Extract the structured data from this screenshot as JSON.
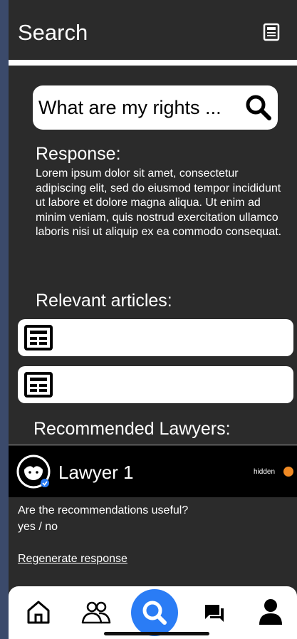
{
  "header": {
    "title": "Search"
  },
  "search": {
    "query": "What are my rights ..."
  },
  "response": {
    "label": "Response:",
    "text": "Lorem ipsum dolor sit amet, consectetur adipiscing elit, sed do eiusmod tempor incididunt ut labore et dolore magna aliqua. Ut enim ad minim veniam, quis nostrud exercitation ullamco laboris nisi ut aliquip ex ea commodo consequat."
  },
  "articles": {
    "label": "Relevant articles:",
    "items": [
      "",
      ""
    ]
  },
  "lawyers": {
    "label": "Recommended Lawyers:",
    "items": [
      {
        "name": "Lawyer 1",
        "status": "hidden",
        "status_color": "#f08a24"
      }
    ]
  },
  "feedback": {
    "question": "Are the recommendations useful?",
    "options": "yes / no"
  },
  "regenerate": {
    "label": "Regenerate response"
  },
  "tabbar": {
    "items": [
      "home-icon",
      "people-icon",
      "search-icon",
      "chat-icon",
      "profile-icon"
    ],
    "active": "search-icon",
    "accent": "#2a7cf5"
  }
}
